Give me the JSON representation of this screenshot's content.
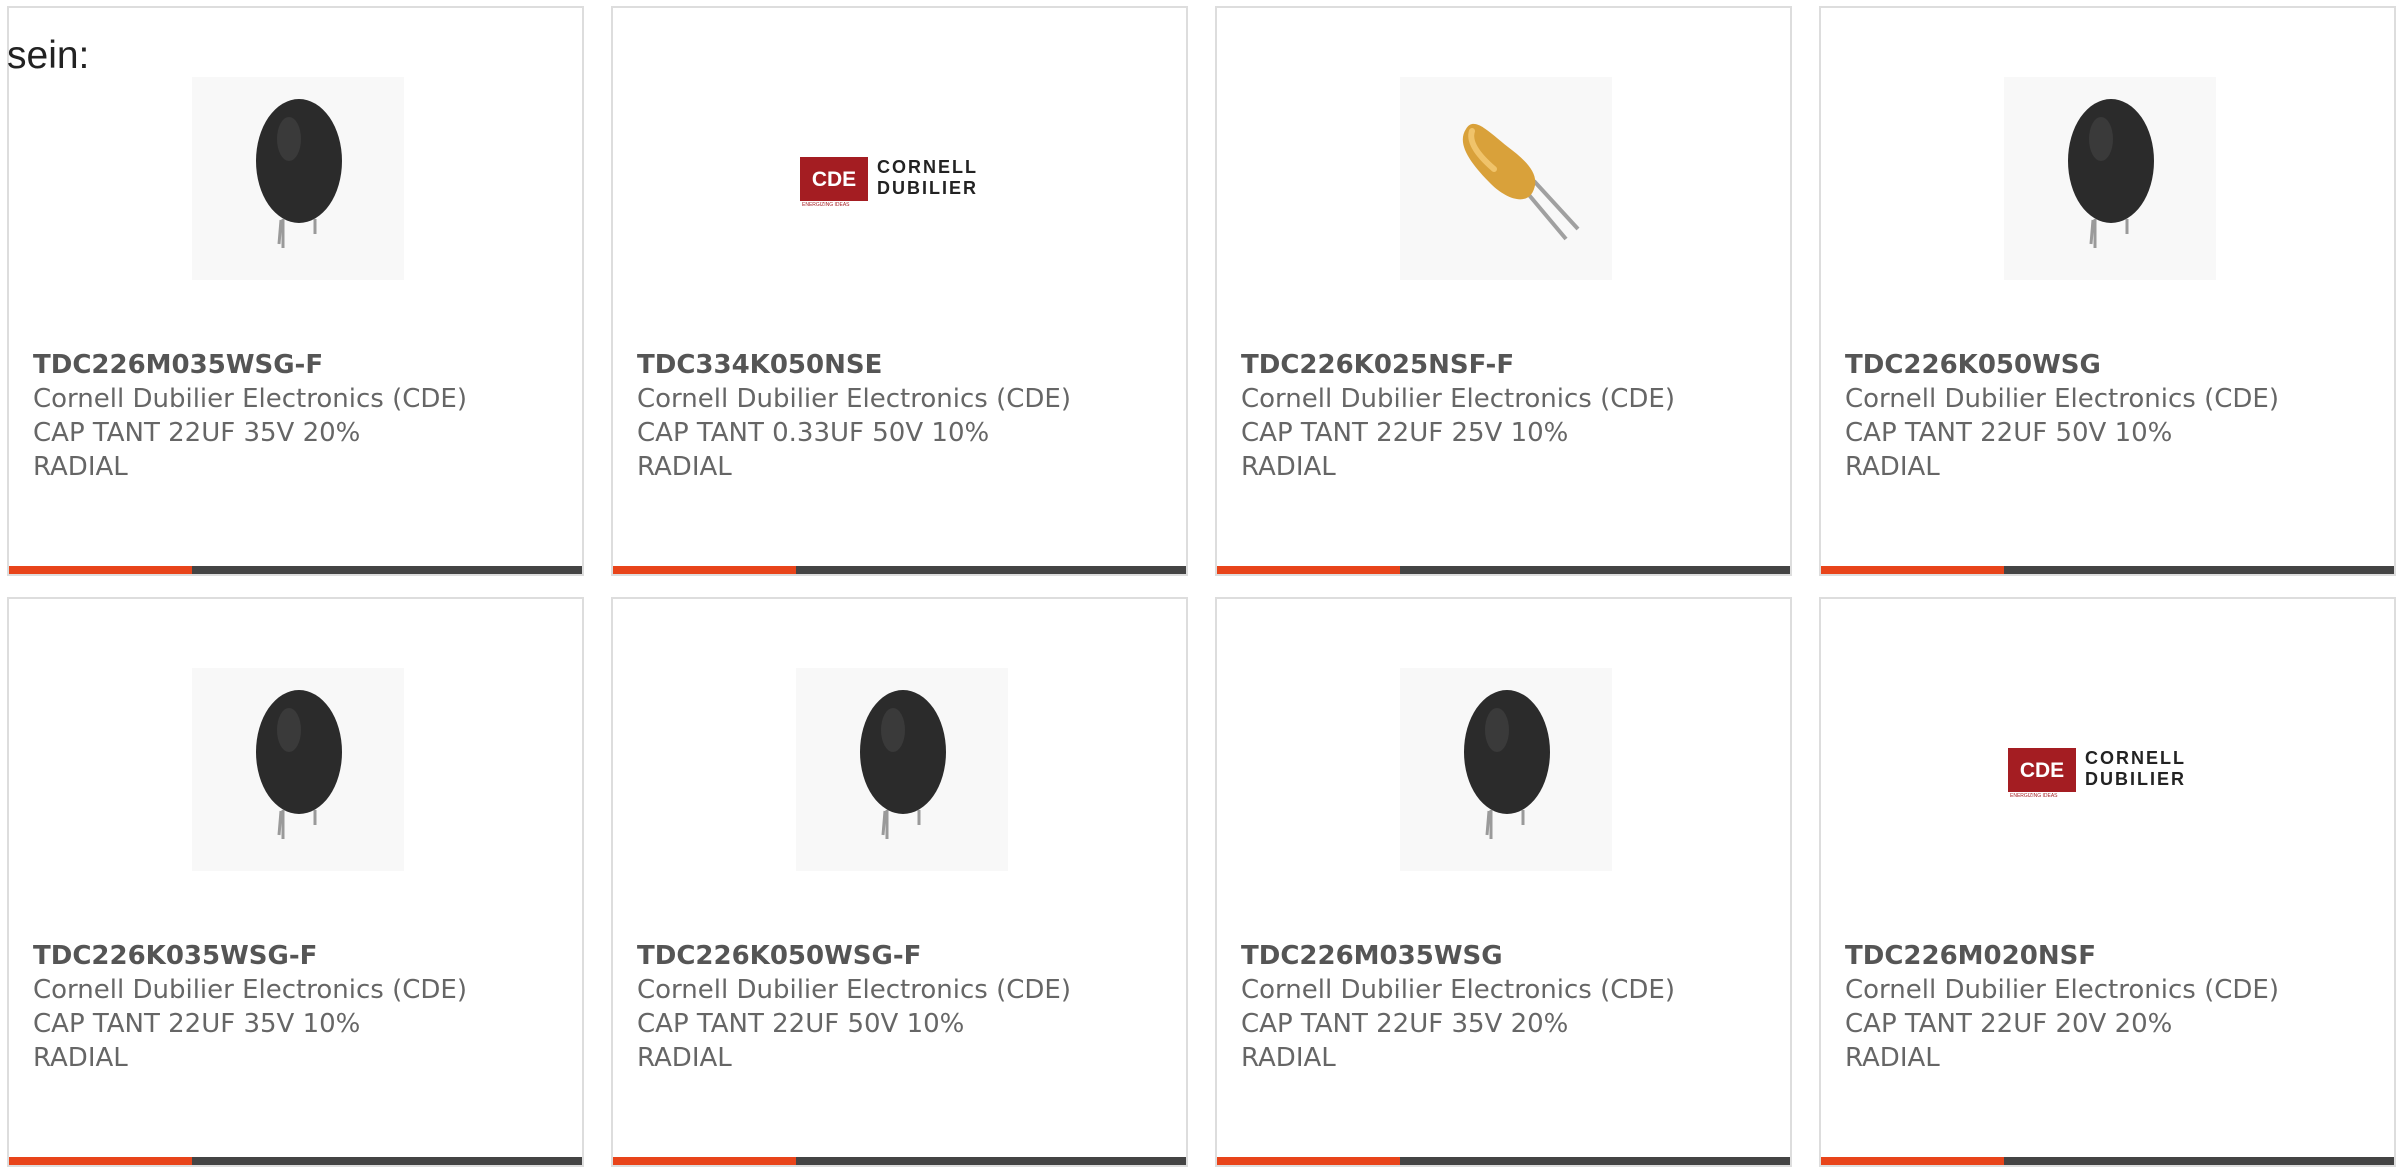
{
  "header": {
    "label": "sein:"
  },
  "accent_color": "#e8441a",
  "bar_color": "#444444",
  "products": [
    {
      "part_number": "TDC226M035WSG-F",
      "manufacturer": "Cornell Dubilier Electronics (CDE)",
      "description": "CAP TANT 22UF 35V 20%",
      "package": "RADIAL",
      "image": "black-tantalum-capacitor-icon"
    },
    {
      "part_number": "TDC334K050NSE",
      "manufacturer": "Cornell Dubilier Electronics (CDE)",
      "description": "CAP TANT 0.33UF 50V 10%",
      "package": "RADIAL",
      "image": "cde-logo",
      "logo": {
        "mark": "CDE",
        "line1": "CORNELL",
        "line2": "DUBILIER",
        "tagline": "ENERGIZING IDEAS"
      }
    },
    {
      "part_number": "TDC226K025NSF-F",
      "manufacturer": "Cornell Dubilier Electronics (CDE)",
      "description": "CAP TANT 22UF 25V 10%",
      "package": "RADIAL",
      "image": "dipped-tantalum-capacitor-icon"
    },
    {
      "part_number": "TDC226K050WSG",
      "manufacturer": "Cornell Dubilier Electronics (CDE)",
      "description": "CAP TANT 22UF 50V 10%",
      "package": "RADIAL",
      "image": "black-tantalum-capacitor-icon"
    },
    {
      "part_number": "TDC226K035WSG-F",
      "manufacturer": "Cornell Dubilier Electronics (CDE)",
      "description": "CAP TANT 22UF 35V 10%",
      "package": "RADIAL",
      "image": "black-tantalum-capacitor-icon"
    },
    {
      "part_number": "TDC226K050WSG-F",
      "manufacturer": "Cornell Dubilier Electronics (CDE)",
      "description": "CAP TANT 22UF 50V 10%",
      "package": "RADIAL",
      "image": "black-tantalum-capacitor-icon"
    },
    {
      "part_number": "TDC226M035WSG",
      "manufacturer": "Cornell Dubilier Electronics (CDE)",
      "description": "CAP TANT 22UF 35V 20%",
      "package": "RADIAL",
      "image": "black-tantalum-capacitor-icon"
    },
    {
      "part_number": "TDC226M020NSF",
      "manufacturer": "Cornell Dubilier Electronics (CDE)",
      "description": "CAP TANT 22UF 20V 20%",
      "package": "RADIAL",
      "image": "cde-logo",
      "logo": {
        "mark": "CDE",
        "line1": "CORNELL",
        "line2": "DUBILIER",
        "tagline": "ENERGIZING IDEAS"
      }
    }
  ]
}
